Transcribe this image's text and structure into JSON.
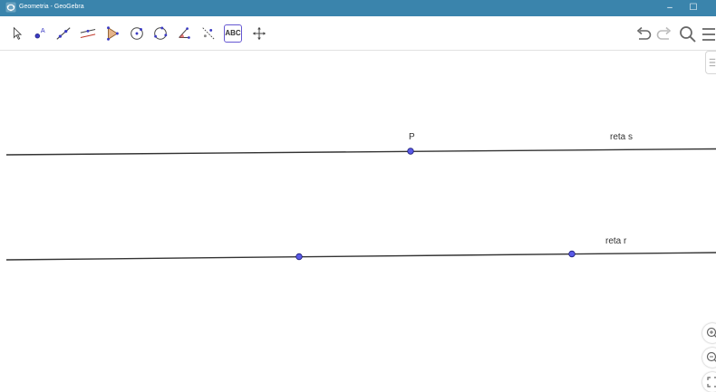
{
  "window": {
    "title": "Geometria - GeoGebra",
    "minimize_glyph": "–",
    "maximize_glyph": "☐"
  },
  "toolbar": {
    "tools": [
      {
        "name": "move-tool",
        "icon": "arrow-pointer-icon"
      },
      {
        "name": "point-tool",
        "icon": "point-icon"
      },
      {
        "name": "line-tool",
        "icon": "line-through-points-icon"
      },
      {
        "name": "perpendicular-line-tool",
        "icon": "perpendicular-line-icon"
      },
      {
        "name": "polygon-tool",
        "icon": "polygon-icon"
      },
      {
        "name": "circle-tool",
        "icon": "circle-center-point-icon"
      },
      {
        "name": "circle-three-points-tool",
        "icon": "circle-three-points-icon"
      },
      {
        "name": "angle-tool",
        "icon": "angle-icon"
      },
      {
        "name": "reflect-tool",
        "icon": "reflect-about-line-icon"
      },
      {
        "name": "text-tool",
        "icon": "text-icon",
        "label": "ABC",
        "selected": true
      },
      {
        "name": "move-graphics-view-tool",
        "icon": "move-graphics-view-icon"
      }
    ],
    "right_tools": [
      "undo-icon",
      "redo-icon",
      "search-icon",
      "menu-icon"
    ]
  },
  "graphics": {
    "points": [
      {
        "name": "P",
        "label": "P"
      },
      {
        "name": "point-on-r-1",
        "label": ""
      },
      {
        "name": "point-on-r-2",
        "label": ""
      }
    ],
    "lines": [
      {
        "name": "reta s",
        "label": "reta s"
      },
      {
        "name": "reta r",
        "label": "reta r"
      }
    ],
    "colors": {
      "point_fill": "#5a5ae8",
      "point_stroke": "#1f1f7a",
      "line": "#333333",
      "titlebar": "#3a84ac",
      "selected_tool_border": "#6557d2"
    }
  },
  "view_controls": [
    "zoom-in-icon",
    "zoom-out-icon",
    "fullscreen-icon"
  ]
}
